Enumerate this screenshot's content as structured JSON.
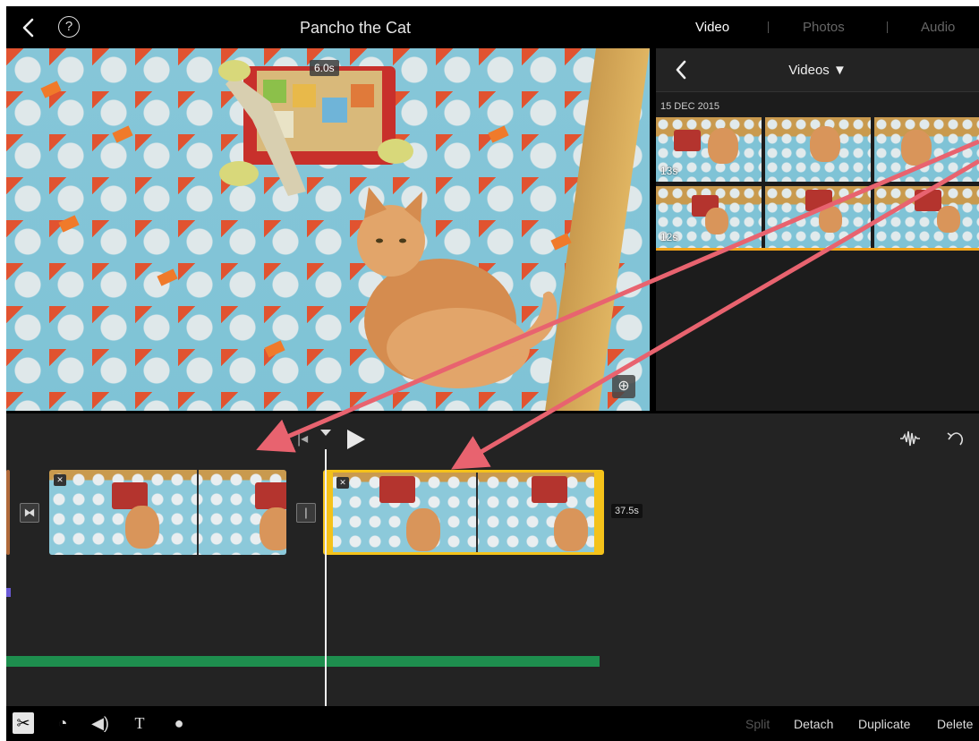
{
  "app": {
    "title": "Pancho the Cat"
  },
  "media_tabs": [
    "Video",
    "Photos",
    "Audio"
  ],
  "viewer": {
    "clip_duration": "6.0s"
  },
  "browser": {
    "title": "Videos ▼",
    "date": "15 DEC 2015",
    "thumbnails": [
      {
        "duration": "13s"
      },
      {
        "duration": "12s"
      }
    ]
  },
  "timeline": {
    "clip_duration": "37.5s"
  },
  "toolbar": {
    "tools": [
      "scissors-icon",
      "speed-icon",
      "volume-icon",
      "text-icon",
      "filter-icon"
    ],
    "actions": [
      "Split",
      "Detach",
      "Duplicate",
      "Delete"
    ]
  },
  "colors": {
    "accent_yellow": "#f4c21a",
    "clip_underline": "#f2a51a",
    "audio_track_green": "#1e8e4e",
    "annotation_arrow": "#e8636f"
  }
}
